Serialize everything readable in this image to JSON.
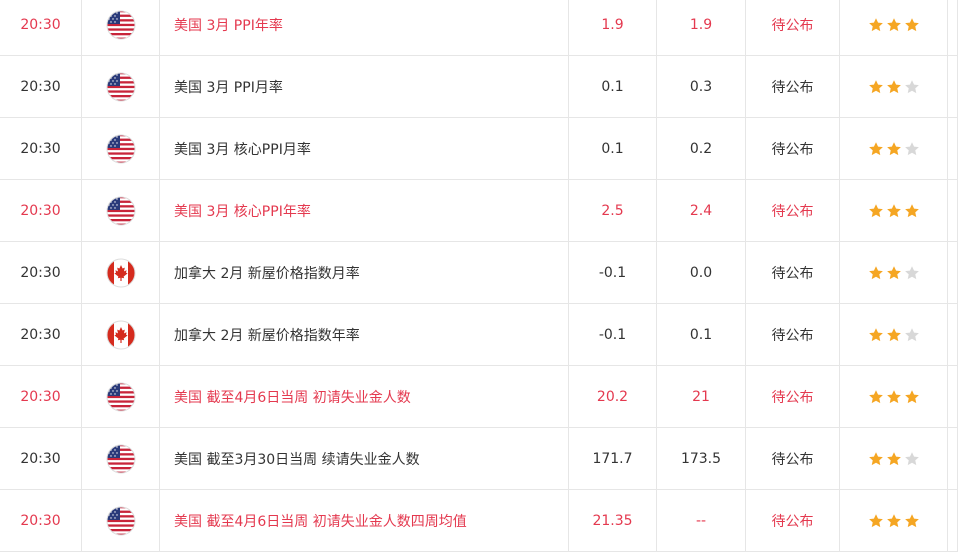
{
  "colors": {
    "highlight": "#e4394f",
    "normal": "#333333",
    "star_on": "#f5a623",
    "star_off": "#d8d8d8",
    "divider": "#e6e6e6"
  },
  "rows": [
    {
      "time": "20:30",
      "flag_icon": "us-flag-icon",
      "country": "美国",
      "name": "美国 3月 PPI年率",
      "previous": "1.9",
      "forecast": "1.9",
      "actual": "待公布",
      "stars": 3,
      "highlight": true
    },
    {
      "time": "20:30",
      "flag_icon": "us-flag-icon",
      "country": "美国",
      "name": "美国 3月 PPI月率",
      "previous": "0.1",
      "forecast": "0.3",
      "actual": "待公布",
      "stars": 2,
      "highlight": false
    },
    {
      "time": "20:30",
      "flag_icon": "us-flag-icon",
      "country": "美国",
      "name": "美国 3月 核心PPI月率",
      "previous": "0.1",
      "forecast": "0.2",
      "actual": "待公布",
      "stars": 2,
      "highlight": false
    },
    {
      "time": "20:30",
      "flag_icon": "us-flag-icon",
      "country": "美国",
      "name": "美国 3月 核心PPI年率",
      "previous": "2.5",
      "forecast": "2.4",
      "actual": "待公布",
      "stars": 3,
      "highlight": true
    },
    {
      "time": "20:30",
      "flag_icon": "canada-flag-icon",
      "country": "加拿大",
      "name": "加拿大 2月 新屋价格指数月率",
      "previous": "-0.1",
      "forecast": "0.0",
      "actual": "待公布",
      "stars": 2,
      "highlight": false
    },
    {
      "time": "20:30",
      "flag_icon": "canada-flag-icon",
      "country": "加拿大",
      "name": "加拿大 2月 新屋价格指数年率",
      "previous": "-0.1",
      "forecast": "0.1",
      "actual": "待公布",
      "stars": 2,
      "highlight": false
    },
    {
      "time": "20:30",
      "flag_icon": "us-flag-icon",
      "country": "美国",
      "name": "美国 截至4月6日当周 初请失业金人数",
      "previous": "20.2",
      "forecast": "21",
      "actual": "待公布",
      "stars": 3,
      "highlight": true
    },
    {
      "time": "20:30",
      "flag_icon": "us-flag-icon",
      "country": "美国",
      "name": "美国 截至3月30日当周 续请失业金人数",
      "previous": "171.7",
      "forecast": "173.5",
      "actual": "待公布",
      "stars": 2,
      "highlight": false
    },
    {
      "time": "20:30",
      "flag_icon": "us-flag-icon",
      "country": "美国",
      "name": "美国 截至4月6日当周 初请失业金人数四周均值",
      "previous": "21.35",
      "forecast": "--",
      "actual": "待公布",
      "stars": 3,
      "highlight": true
    }
  ]
}
